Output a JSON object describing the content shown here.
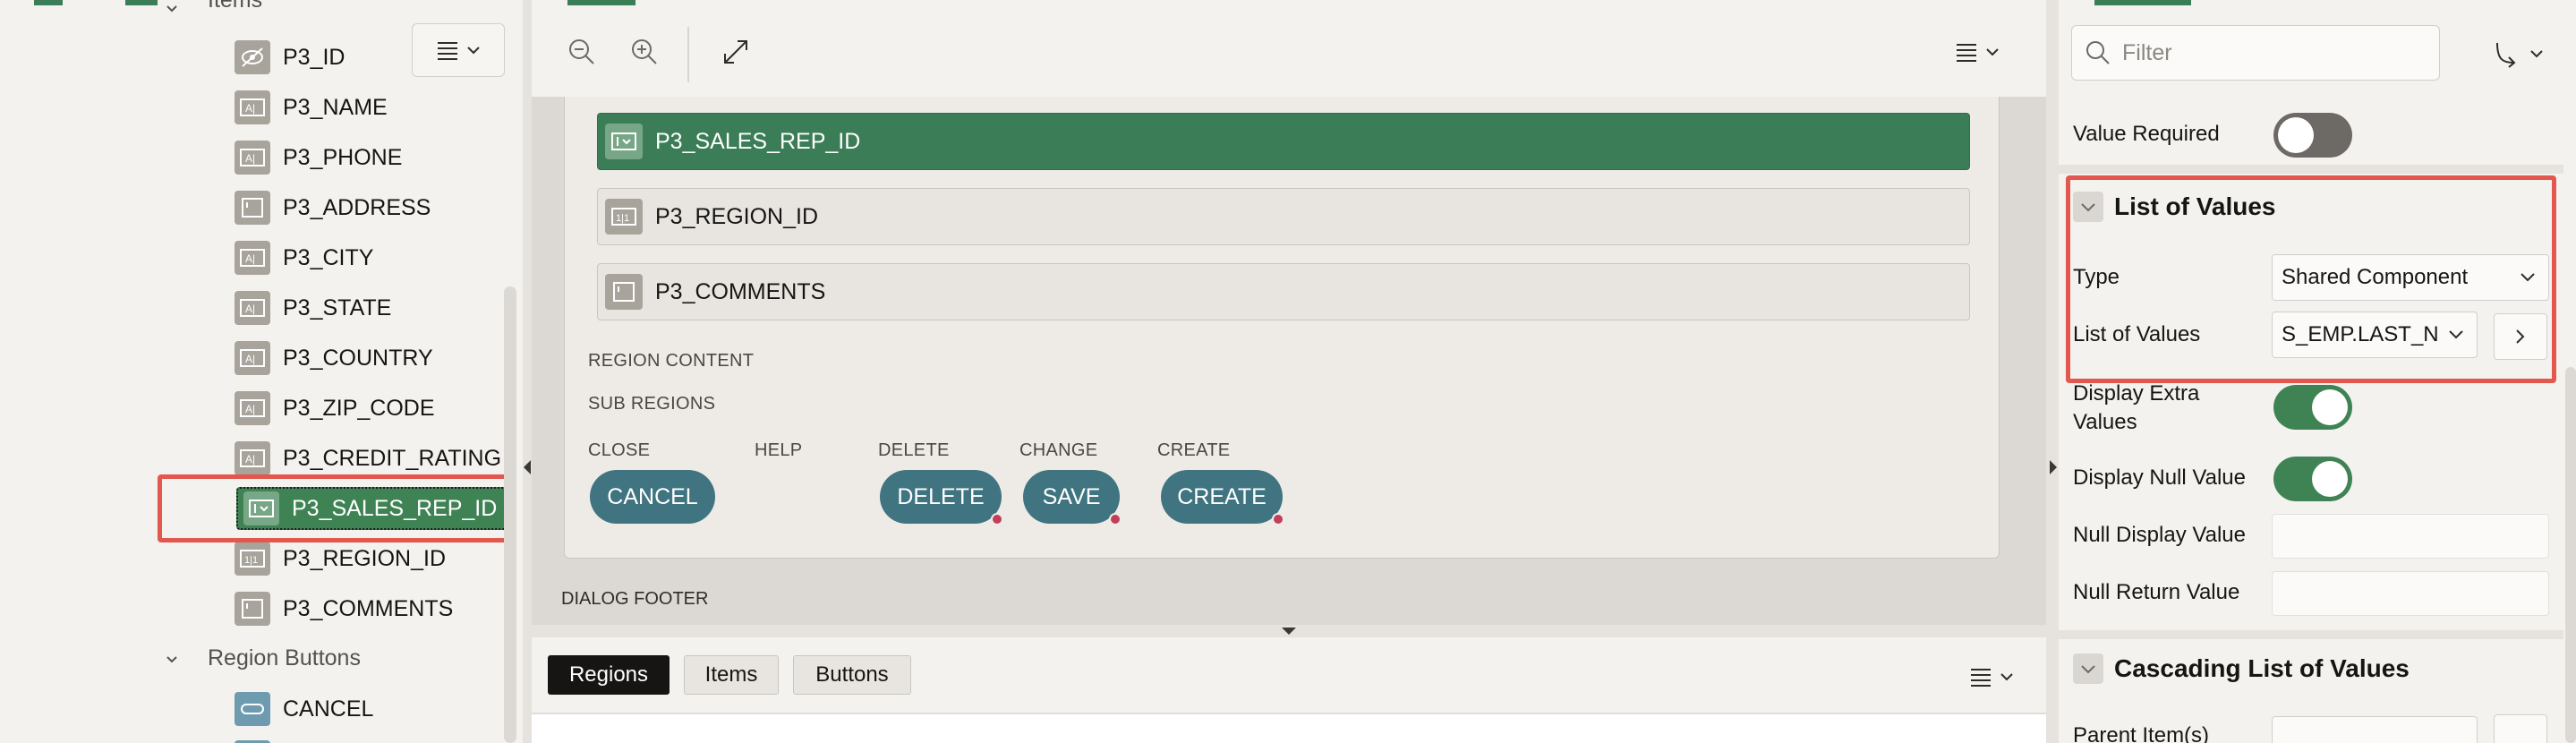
{
  "tree": {
    "items_caption": "Items",
    "items": [
      {
        "label": "P3_ID",
        "icon": "hidden-item-icon"
      },
      {
        "label": "P3_NAME",
        "icon": "text-field-icon"
      },
      {
        "label": "P3_PHONE",
        "icon": "text-field-icon"
      },
      {
        "label": "P3_ADDRESS",
        "icon": "textarea-icon"
      },
      {
        "label": "P3_CITY",
        "icon": "text-field-icon"
      },
      {
        "label": "P3_STATE",
        "icon": "text-field-icon"
      },
      {
        "label": "P3_COUNTRY",
        "icon": "text-field-icon"
      },
      {
        "label": "P3_ZIP_CODE",
        "icon": "text-field-icon"
      },
      {
        "label": "P3_CREDIT_RATING",
        "icon": "text-field-icon"
      },
      {
        "label": "P3_SALES_REP_ID",
        "icon": "select-list-icon",
        "selected": true
      },
      {
        "label": "P3_REGION_ID",
        "icon": "number-field-icon"
      },
      {
        "label": "P3_COMMENTS",
        "icon": "textarea-icon"
      }
    ],
    "region_buttons_caption": "Region Buttons",
    "buttons": [
      {
        "label": "CANCEL",
        "icon": "button-icon"
      }
    ]
  },
  "layout_canvas": {
    "items": [
      {
        "label": "P3_SALES_REP_ID",
        "active": true
      },
      {
        "label": "P3_REGION_ID",
        "active": false
      },
      {
        "label": "P3_COMMENTS",
        "active": false
      }
    ],
    "region_content": "REGION CONTENT",
    "sub_regions": "SUB REGIONS",
    "slots": {
      "close": "CLOSE",
      "help": "HELP",
      "delete": "DELETE",
      "change": "CHANGE",
      "create": "CREATE"
    },
    "buttons": {
      "cancel": "CANCEL",
      "delete": "DELETE",
      "save": "SAVE",
      "create": "CREATE"
    },
    "dialog_footer": "DIALOG FOOTER"
  },
  "bottom_tabs": {
    "regions": "Regions",
    "items": "Items",
    "buttons": "Buttons"
  },
  "properties": {
    "filter_placeholder": "Filter",
    "value_required": "Value Required",
    "lov_group": "List of Values",
    "type_label": "Type",
    "type_value": "Shared Component",
    "lov_label": "List of Values",
    "lov_value": "S_EMP.LAST_N",
    "display_extra_values": "Display Extra Values",
    "display_null_value": "Display Null Value",
    "null_display_value": "Null Display Value",
    "null_return_value": "Null Return Value",
    "cascading_group": "Cascading List of Values",
    "parent_items": "Parent Item(s)"
  },
  "colors": {
    "accent_green": "#3a7d56",
    "button_teal": "#3f7480",
    "highlight_red": "#e2574e"
  }
}
